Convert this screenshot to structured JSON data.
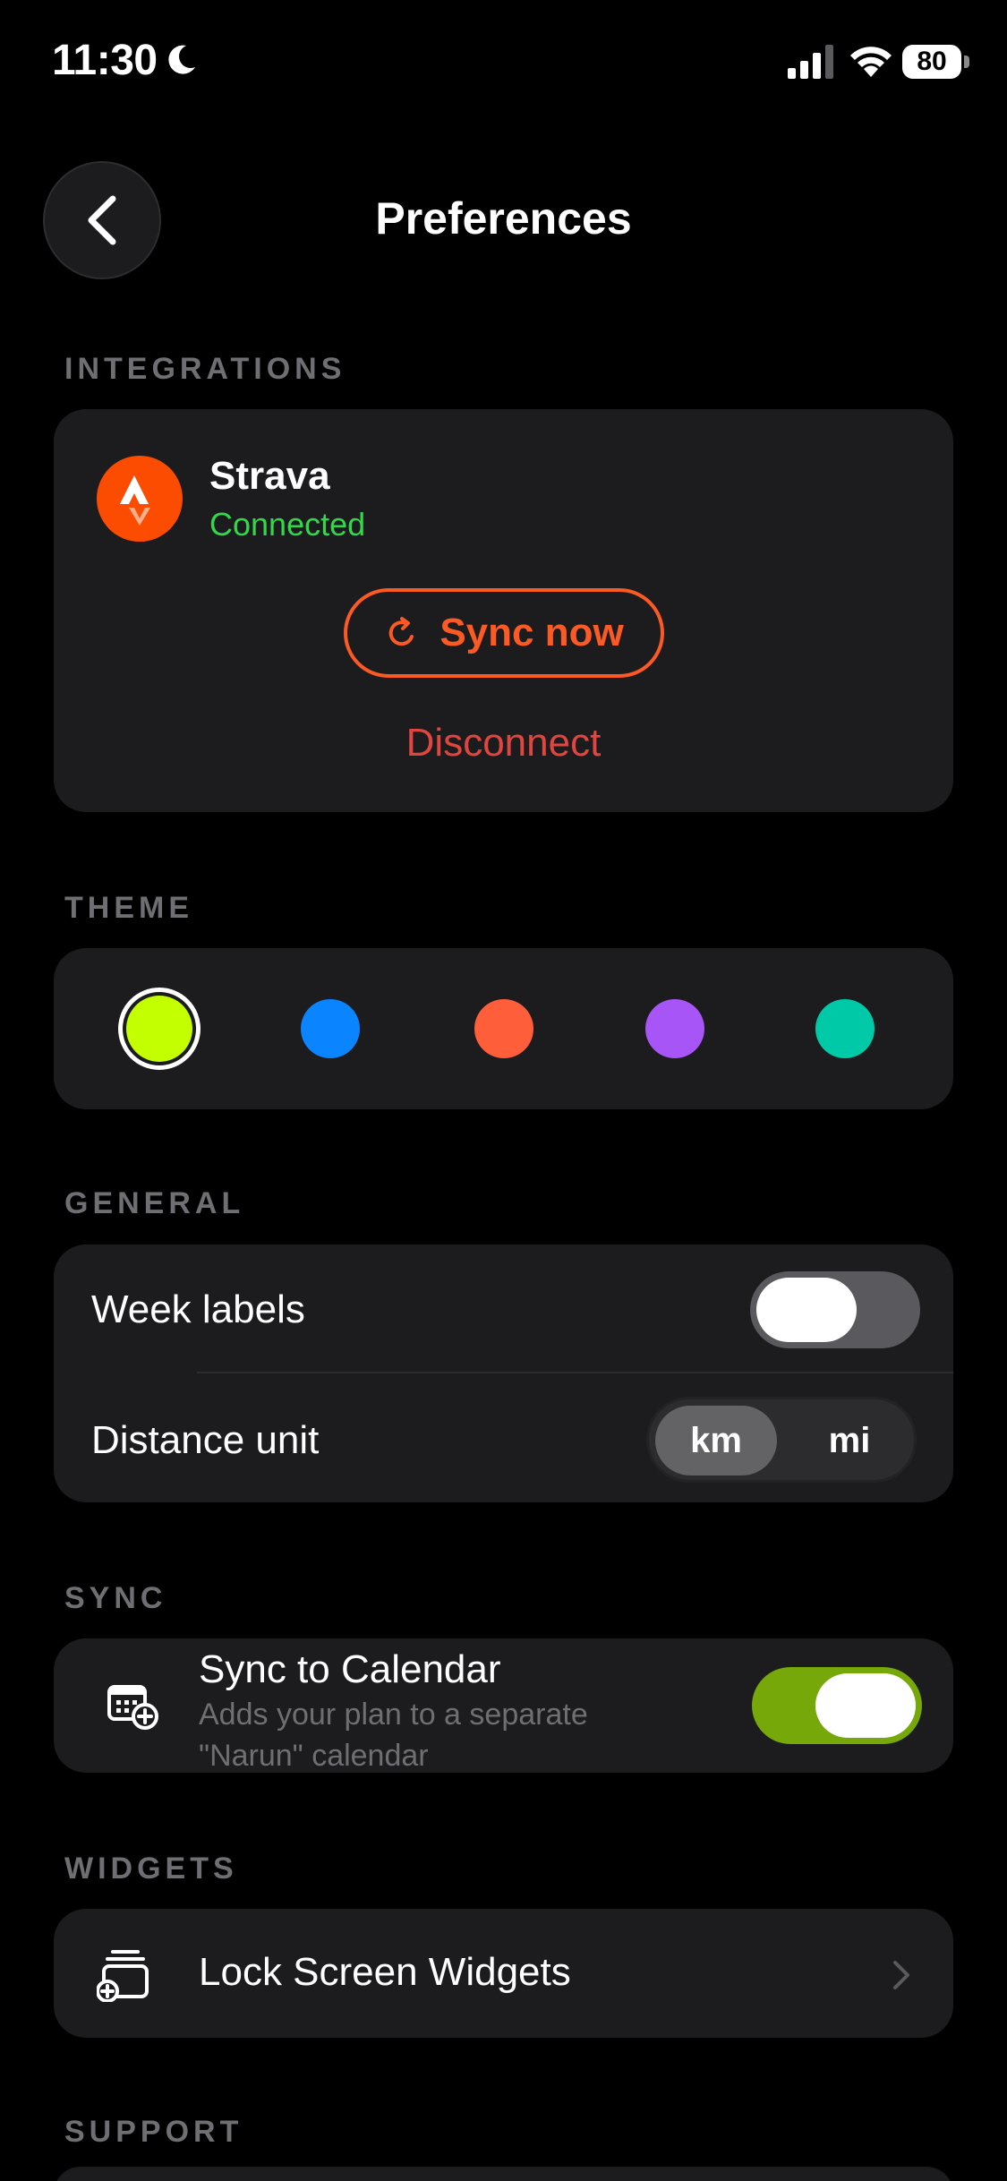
{
  "status_bar": {
    "time": "11:30",
    "battery": "80",
    "icons": [
      "moon-icon",
      "cellular-signal-icon",
      "wifi-icon",
      "battery-icon"
    ]
  },
  "nav": {
    "title": "Preferences",
    "back_icon": "chevron-left-icon"
  },
  "integrations": {
    "header": "INTEGRATIONS",
    "service_name": "Strava",
    "service_status": "Connected",
    "sync_label": "Sync now",
    "disconnect_label": "Disconnect",
    "brand_color": "#fc4c02",
    "status_color": "#32d74b"
  },
  "theme": {
    "header": "THEME",
    "colors": [
      "#c3ff00",
      "#0a84ff",
      "#ff5e3a",
      "#a855f7",
      "#00c9a7"
    ],
    "selected_index": 0
  },
  "general": {
    "header": "GENERAL",
    "week_labels": {
      "label": "Week labels",
      "enabled": false
    },
    "distance_unit": {
      "label": "Distance unit",
      "options": [
        "km",
        "mi"
      ],
      "selected": "km"
    }
  },
  "sync": {
    "header": "SYNC",
    "title": "Sync to Calendar",
    "subtitle": "Adds your plan to a separate \"Narun\" calendar",
    "enabled": true,
    "toggle_color": "#76a80a"
  },
  "widgets": {
    "header": "WIDGETS",
    "label": "Lock Screen Widgets"
  },
  "support": {
    "header": "SUPPORT"
  }
}
